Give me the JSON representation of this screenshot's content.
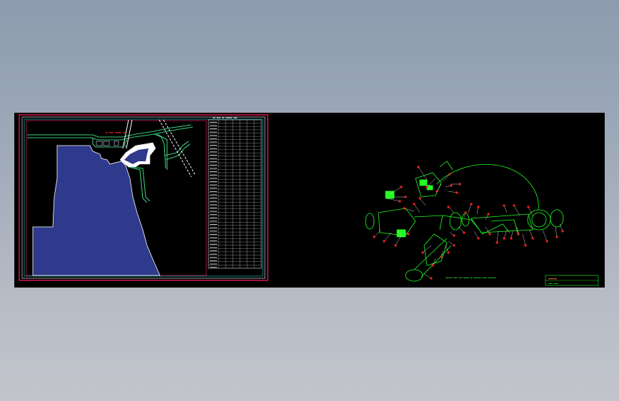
{
  "viewer": {
    "background": "#a0aab8",
    "canvas_background": "#000000"
  },
  "drawing_left": {
    "kind": "site-plan",
    "frame_colors": {
      "outer": "#c0164e",
      "inner": "#ffffff",
      "border_band": "#2bd6d6"
    },
    "region_fill": "#2f3a8c",
    "road_color": "#38c878",
    "title_color": "#ff2020",
    "table_rows": 45,
    "table_cols": 7
  },
  "drawing_right": {
    "kind": "exploded-assembly",
    "line_color": "#22ff22",
    "callout_color": "#ff2020",
    "title_block_color": "#22ff22",
    "title_text_color": "#ff5a2a"
  }
}
